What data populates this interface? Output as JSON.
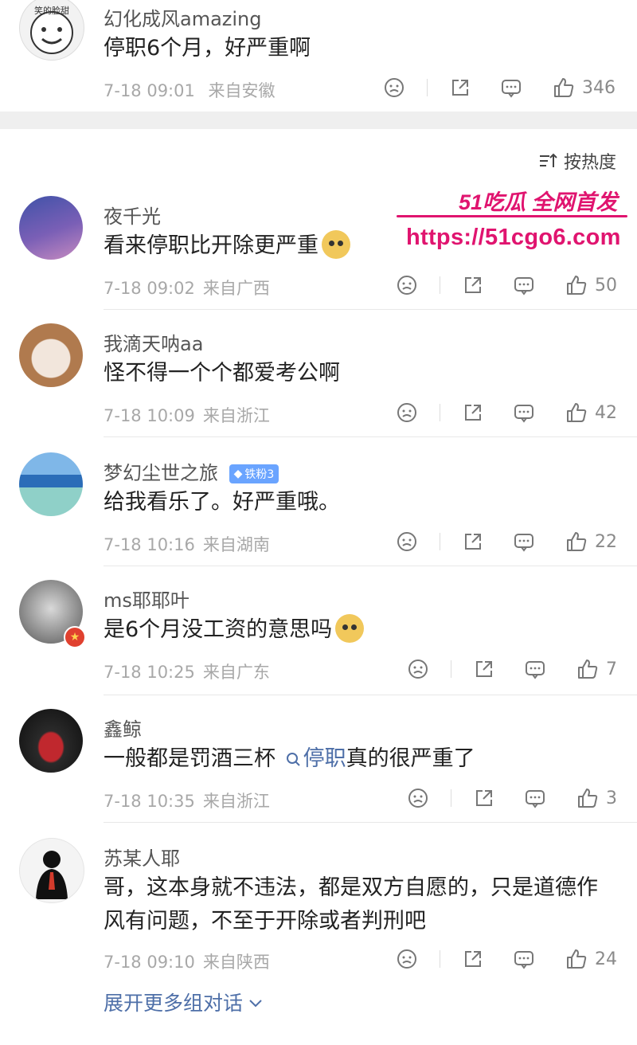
{
  "sort": {
    "label": "按热度",
    "icon": "sort-icon"
  },
  "watermark": {
    "line1": "51吃瓜 全网首发",
    "url": "https://51cgo6.com"
  },
  "top_comment": {
    "username": "幻化成风amazing",
    "avatar_text": "笑的脸甜",
    "text": "停职6个月，好严重啊",
    "time": "7-18 09:01",
    "location": "来自安徽",
    "likes": "346"
  },
  "comments": [
    {
      "username": "夜千光",
      "text": "看来停职比开除更严重",
      "time": "7-18 09:02",
      "location": "来自广西",
      "likes": "50",
      "emoji": "doge-emoji"
    },
    {
      "username": "我滴天呐aa",
      "text": "怪不得一个个都爱考公啊",
      "time": "7-18 10:09",
      "location": "来自浙江",
      "likes": "42"
    },
    {
      "username": "梦幻尘世之旅",
      "badge": "铁粉3",
      "text": "给我看乐了。好严重哦。",
      "time": "7-18 10:16",
      "location": "来自湖南",
      "likes": "22"
    },
    {
      "username": "ms耶耶叶",
      "text": "是6个月没工资的意思吗",
      "time": "7-18 10:25",
      "location": "来自广东",
      "likes": "7",
      "emoji": "doge-emoji"
    },
    {
      "username": "鑫鲸",
      "text_before": "一般都是罚酒三杯 ",
      "topic": "停职",
      "text_after": "真的很严重了",
      "time": "7-18 10:35",
      "location": "来自浙江",
      "likes": "3"
    },
    {
      "username": "苏某人耶",
      "text_line1": "哥，这本身就不违法，都是双方自愿的，只是道德作",
      "text_line2": "风有问题，不至于开除或者判刑吧",
      "time": "7-18 09:10",
      "location": "来自陕西",
      "likes": "24"
    }
  ],
  "expand": {
    "label": "展开更多组对话"
  },
  "colors": {
    "link": "#4e6fa8",
    "watermark": "#e0146f",
    "meta": "#a8a8a8"
  }
}
